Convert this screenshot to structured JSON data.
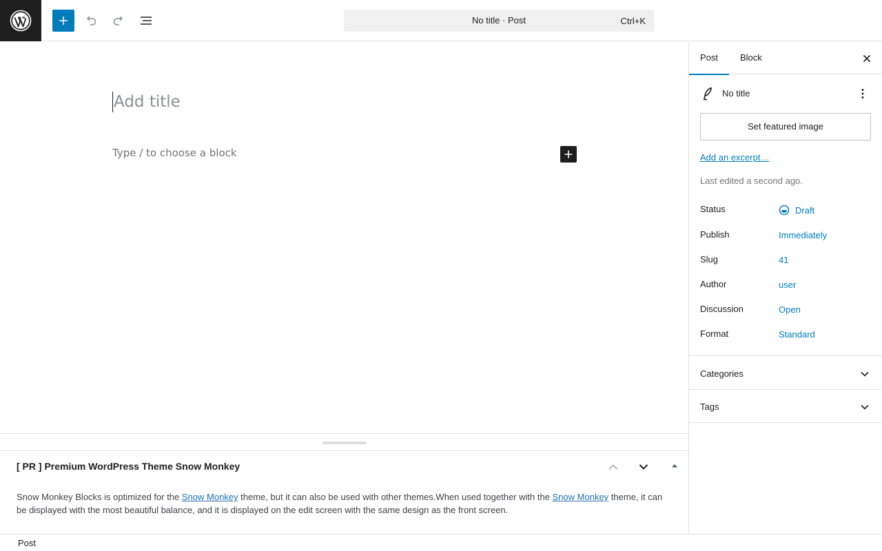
{
  "toolbar": {
    "logo_icon": "wordpress-icon",
    "inserter_icon": "plus-icon",
    "undo_icon": "undo-icon",
    "redo_icon": "redo-icon",
    "listview_icon": "list-view-icon",
    "command_title": "No title · Post",
    "command_shortcut": "Ctrl+K",
    "accent": "#007cba"
  },
  "editor": {
    "title_placeholder": "Add title",
    "block_placeholder": "Type / to choose a block",
    "add_block_icon": "plus-icon"
  },
  "metabox": {
    "title": "[ PR ] Premium WordPress Theme Snow Monkey",
    "text_part1": "Snow Monkey Blocks is optimized for the ",
    "link1": "Snow Monkey",
    "text_part2": " theme, but it can also be used with other themes.When used together with the ",
    "link2": "Snow Monkey",
    "text_part3": " theme, it can be displayed with the most beautiful balance, and it is displayed on the edit screen with the same design as the front screen."
  },
  "footer": {
    "breadcrumb": "Post"
  },
  "sidebar": {
    "tabs": [
      {
        "label": "Post",
        "active": true
      },
      {
        "label": "Block",
        "active": false
      }
    ],
    "post_title": "No title",
    "featured_image_button": "Set featured image",
    "excerpt_link": "Add an excerpt…",
    "last_edited": "Last edited a second ago.",
    "meta": [
      {
        "label": "Status",
        "value": "Draft"
      },
      {
        "label": "Publish",
        "value": "Immediately"
      },
      {
        "label": "Slug",
        "value": "41"
      },
      {
        "label": "Author",
        "value": "user"
      },
      {
        "label": "Discussion",
        "value": "Open"
      },
      {
        "label": "Format",
        "value": "Standard"
      }
    ],
    "panels": [
      {
        "label": "Categories"
      },
      {
        "label": "Tags"
      }
    ]
  }
}
